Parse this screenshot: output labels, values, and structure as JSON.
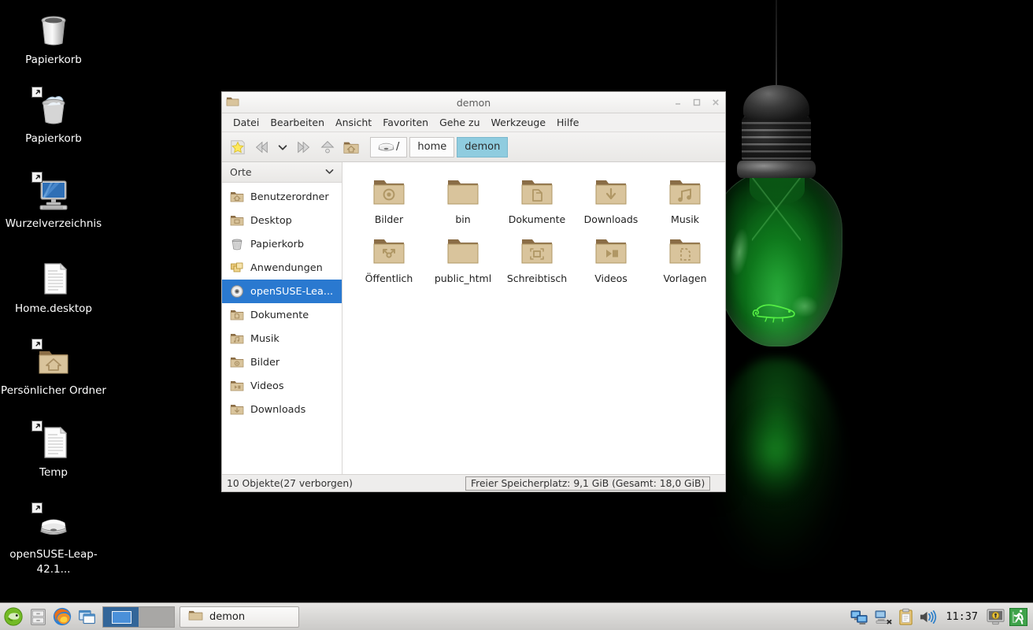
{
  "desktop": {
    "icons": [
      {
        "label": "Papierkorb",
        "icon": "trash-empty-icon",
        "shortcut": false
      },
      {
        "label": "Papierkorb",
        "icon": "trash-full-icon",
        "shortcut": true
      },
      {
        "label": "Wurzelverzeichnis",
        "icon": "computer-icon",
        "shortcut": true
      },
      {
        "label": "Home.desktop",
        "icon": "text-file-icon",
        "shortcut": false
      },
      {
        "label": "Persönlicher Ordner",
        "icon": "home-folder-icon",
        "shortcut": true
      },
      {
        "label": "Temp",
        "icon": "text-file-icon",
        "shortcut": true
      },
      {
        "label": "openSUSE-Leap-42.1...",
        "icon": "optical-drive-icon",
        "shortcut": true
      }
    ]
  },
  "window": {
    "title": "demon",
    "app_icon": "folder-icon",
    "buttons": {
      "minimize": "–",
      "maximize": "□",
      "close": "×"
    },
    "menu": [
      "Datei",
      "Bearbeiten",
      "Ansicht",
      "Favoriten",
      "Gehe zu",
      "Werkzeuge",
      "Hilfe"
    ],
    "toolbar_icons": [
      "bookmark-star-icon",
      "back-arrow-icon",
      "history-dropdown-icon",
      "forward-arrow-icon",
      "parent-folder-icon",
      "home-icon"
    ],
    "breadcrumbs": [
      {
        "label": "/",
        "icon": "drive-icon",
        "active": false
      },
      {
        "label": "home",
        "icon": null,
        "active": false
      },
      {
        "label": "demon",
        "icon": null,
        "active": true
      }
    ],
    "sidebar": {
      "header": "Orte",
      "header_icon": "chevron-down-icon",
      "items": [
        {
          "label": "Benutzerordner",
          "icon": "home-folder-icon",
          "selected": false
        },
        {
          "label": "Desktop",
          "icon": "desktop-folder-icon",
          "selected": false
        },
        {
          "label": "Papierkorb",
          "icon": "trash-icon",
          "selected": false
        },
        {
          "label": "Anwendungen",
          "icon": "applications-icon",
          "selected": false
        },
        {
          "label": "openSUSE-Lea...",
          "icon": "optical-disc-icon",
          "selected": true
        },
        {
          "label": "Dokumente",
          "icon": "documents-folder-icon",
          "selected": false
        },
        {
          "label": "Musik",
          "icon": "music-folder-icon",
          "selected": false
        },
        {
          "label": "Bilder",
          "icon": "pictures-folder-icon",
          "selected": false
        },
        {
          "label": "Videos",
          "icon": "videos-folder-icon",
          "selected": false
        },
        {
          "label": "Downloads",
          "icon": "downloads-folder-icon",
          "selected": false
        }
      ]
    },
    "files": [
      {
        "name": "Bilder",
        "icon": "pictures-folder-icon"
      },
      {
        "name": "bin",
        "icon": "folder-icon"
      },
      {
        "name": "Dokumente",
        "icon": "documents-folder-icon"
      },
      {
        "name": "Downloads",
        "icon": "downloads-folder-icon"
      },
      {
        "name": "Musik",
        "icon": "music-folder-icon"
      },
      {
        "name": "Öffentlich",
        "icon": "public-folder-icon"
      },
      {
        "name": "public_html",
        "icon": "folder-icon"
      },
      {
        "name": "Schreibtisch",
        "icon": "desktop-folder-icon"
      },
      {
        "name": "Videos",
        "icon": "videos-folder-icon"
      },
      {
        "name": "Vorlagen",
        "icon": "templates-folder-icon"
      }
    ],
    "status": {
      "left": "10 Objekte(27 verborgen)",
      "right": "Freier Speicherplatz: 9,1 GiB (Gesamt: 18,0 GiB)"
    }
  },
  "taskbar": {
    "launchers": [
      {
        "icon": "opensuse-menu-icon",
        "label": "openSUSE-Menü"
      },
      {
        "icon": "file-manager-icon",
        "label": "Dateimanager"
      },
      {
        "icon": "firefox-icon",
        "label": "Firefox"
      },
      {
        "icon": "show-desktop-icon",
        "label": "Fenster anzeigen"
      }
    ],
    "pager": [
      {
        "active": true,
        "has_window": true
      },
      {
        "active": false,
        "has_window": false
      }
    ],
    "tasks": [
      {
        "label": "demon",
        "icon": "folder-icon",
        "active": true
      }
    ],
    "tray": [
      {
        "icon": "network-connected-icon"
      },
      {
        "icon": "network-disconnected-icon"
      },
      {
        "icon": "clipboard-icon"
      },
      {
        "icon": "volume-icon"
      }
    ],
    "clock": "11:37",
    "tray_right": [
      {
        "icon": "lock-screen-icon"
      },
      {
        "icon": "logout-icon"
      }
    ]
  },
  "colors": {
    "selection_blue": "#2a79d0",
    "crumb_active": "#8fccdf",
    "bulb_green": "#0d7a1c",
    "taskbar_bg": "#d9d8d6",
    "window_bg": "#f2f1f0"
  }
}
